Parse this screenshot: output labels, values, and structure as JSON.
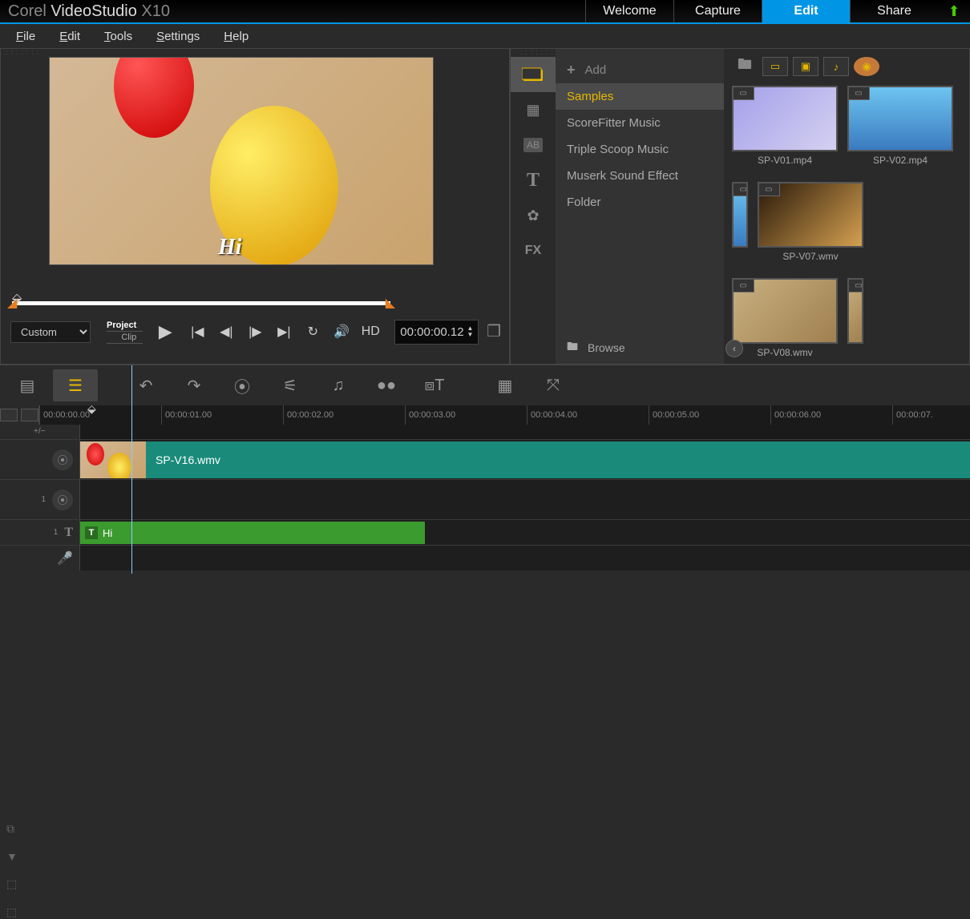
{
  "title": {
    "brand": "Corel",
    "product": "VideoStudio",
    "version": "X10"
  },
  "tabs": [
    "Welcome",
    "Capture",
    "Edit",
    "Share"
  ],
  "activeTab": "Edit",
  "menu": [
    "File",
    "Edit",
    "Tools",
    "Settings",
    "Help"
  ],
  "preview": {
    "overlayText": "Hi",
    "mode": "Custom",
    "projectLabel": "Project",
    "clipLabel": "Clip",
    "hdLabel": "HD",
    "timecode": "00:00:00.12"
  },
  "library": {
    "addLabel": "Add",
    "categories": [
      "Samples",
      "ScoreFitter Music",
      "Triple Scoop Music",
      "Muserk Sound Effect",
      "Folder"
    ],
    "activeCategory": "Samples",
    "browseLabel": "Browse",
    "sideTools": [
      "media",
      "transitions",
      "ab",
      "title",
      "graphics",
      "fx"
    ],
    "thumbs": [
      {
        "name": "SP-V01.mp4"
      },
      {
        "name": "SP-V02.mp4"
      },
      {
        "name": "SP-V07.wmv"
      },
      {
        "name": "SP-V08.wmv"
      }
    ]
  },
  "timeline": {
    "ticks": [
      "00:00:00.00",
      "00:00:01.00",
      "00:00:02.00",
      "00:00:03.00",
      "00:00:04.00",
      "00:00:05.00",
      "00:00:06.00",
      "00:00:07."
    ],
    "zoomLabel": "+/−",
    "videoClip": "SP-V16.wmv",
    "titleClip": "Hi"
  }
}
